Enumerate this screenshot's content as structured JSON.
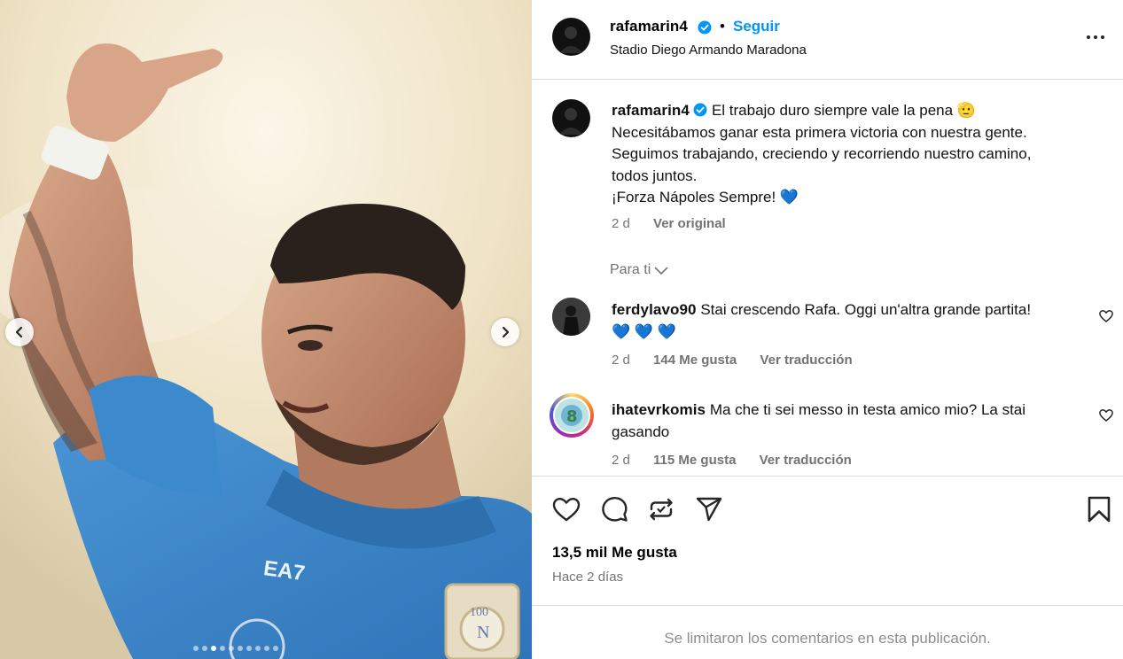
{
  "post": {
    "username": "rafamarin4",
    "bullet": "•",
    "follow_label": "Seguir",
    "location": "Stadio Diego Armando Maradona",
    "more_icon": "more-horizontal-icon"
  },
  "caption": {
    "username": "rafamarin4",
    "lines": [
      "El trabajo duro siempre vale la pena 🫡",
      "Necesitábamos ganar esta primera victoria con nuestra gente.",
      "Seguimos trabajando, creciendo y recorriendo nuestro camino,",
      "todos juntos.",
      "¡Forza Nápoles Sempre! 💙"
    ],
    "time": "2 d",
    "see_original": "Ver original"
  },
  "filter": {
    "label": "Para ti"
  },
  "comments": [
    {
      "username": "ferdylavo90",
      "text": "Stai crescendo Rafa. Oggi un'altra grande partita!",
      "text2": "💙 💙 💙",
      "time": "2 d",
      "likes": "144 Me gusta",
      "translate": "Ver traducción"
    },
    {
      "username": "ihatevrkomis",
      "text": "Ma che ti sei messo in testa amico mio? La stai",
      "text2": "gasando",
      "time": "2 d",
      "likes": "115 Me gusta",
      "translate": "Ver traducción"
    }
  ],
  "stats": {
    "likes": "13,5 mil Me gusta",
    "when": "Hace 2 días"
  },
  "footer": {
    "limited": "Se limitaron los comentarios en esta publicación."
  },
  "carousel": {
    "slide_count": 10,
    "active_index": 2
  },
  "colors": {
    "link": "#0095f6",
    "verified": "#0095f6",
    "muted": "#737373",
    "jersey": "#3a86c8"
  }
}
